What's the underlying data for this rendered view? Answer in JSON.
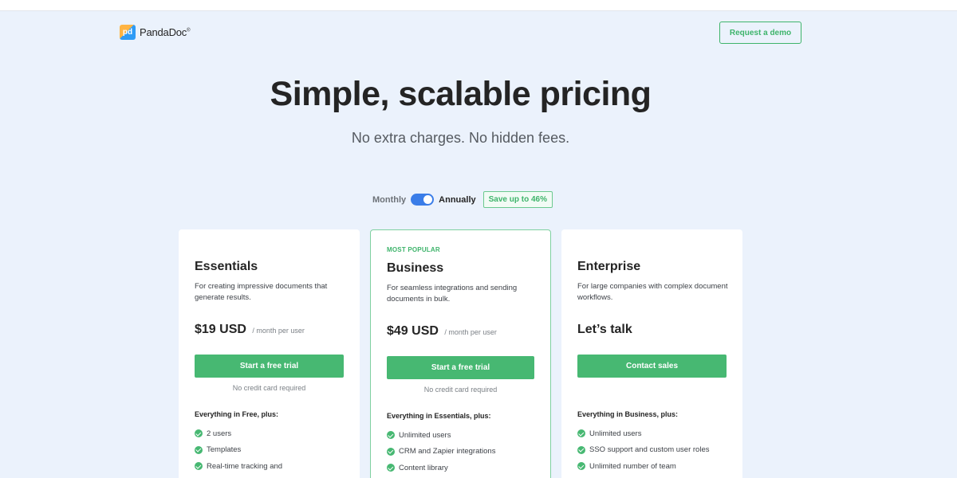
{
  "header": {
    "logo_mark": "pd",
    "logo_text": "PandaDoc",
    "logo_reg": "®",
    "demo_label": "Request a demo"
  },
  "hero": {
    "title": "Simple, scalable pricing",
    "subtitle": "No extra charges. No hidden fees."
  },
  "billing": {
    "monthly": "Monthly",
    "annually": "Annually",
    "save_badge": "Save up to 46%",
    "selected": "Annually"
  },
  "colors": {
    "background": "#ebf2fc",
    "accent_green": "#47b872",
    "toggle_blue": "#3a7de8"
  },
  "plans": [
    {
      "name": "Essentials",
      "description": "For creating impressive documents that generate results.",
      "price": "$19 USD",
      "price_unit": "/ month per user",
      "cta": "Start a free trial",
      "note": "No credit card required",
      "features_title": "Everything in Free, plus:",
      "features": [
        "2 users",
        "Templates",
        "Real-time tracking and"
      ]
    },
    {
      "badge": "MOST POPULAR",
      "name": "Business",
      "description": "For seamless integrations and sending documents in bulk.",
      "price": "$49 USD",
      "price_unit": "/ month per user",
      "cta": "Start a free trial",
      "note": "No credit card required",
      "features_title": "Everything in Essentials, plus:",
      "features": [
        "Unlimited users",
        "CRM and Zapier integrations",
        "Content library"
      ]
    },
    {
      "name": "Enterprise",
      "description": "For large companies with complex document workflows.",
      "price": "Let’s talk",
      "cta": "Contact sales",
      "features_title": "Everything in Business, plus:",
      "features": [
        "Unlimited users",
        "SSO support and custom user roles",
        "Unlimited number of team"
      ]
    }
  ]
}
